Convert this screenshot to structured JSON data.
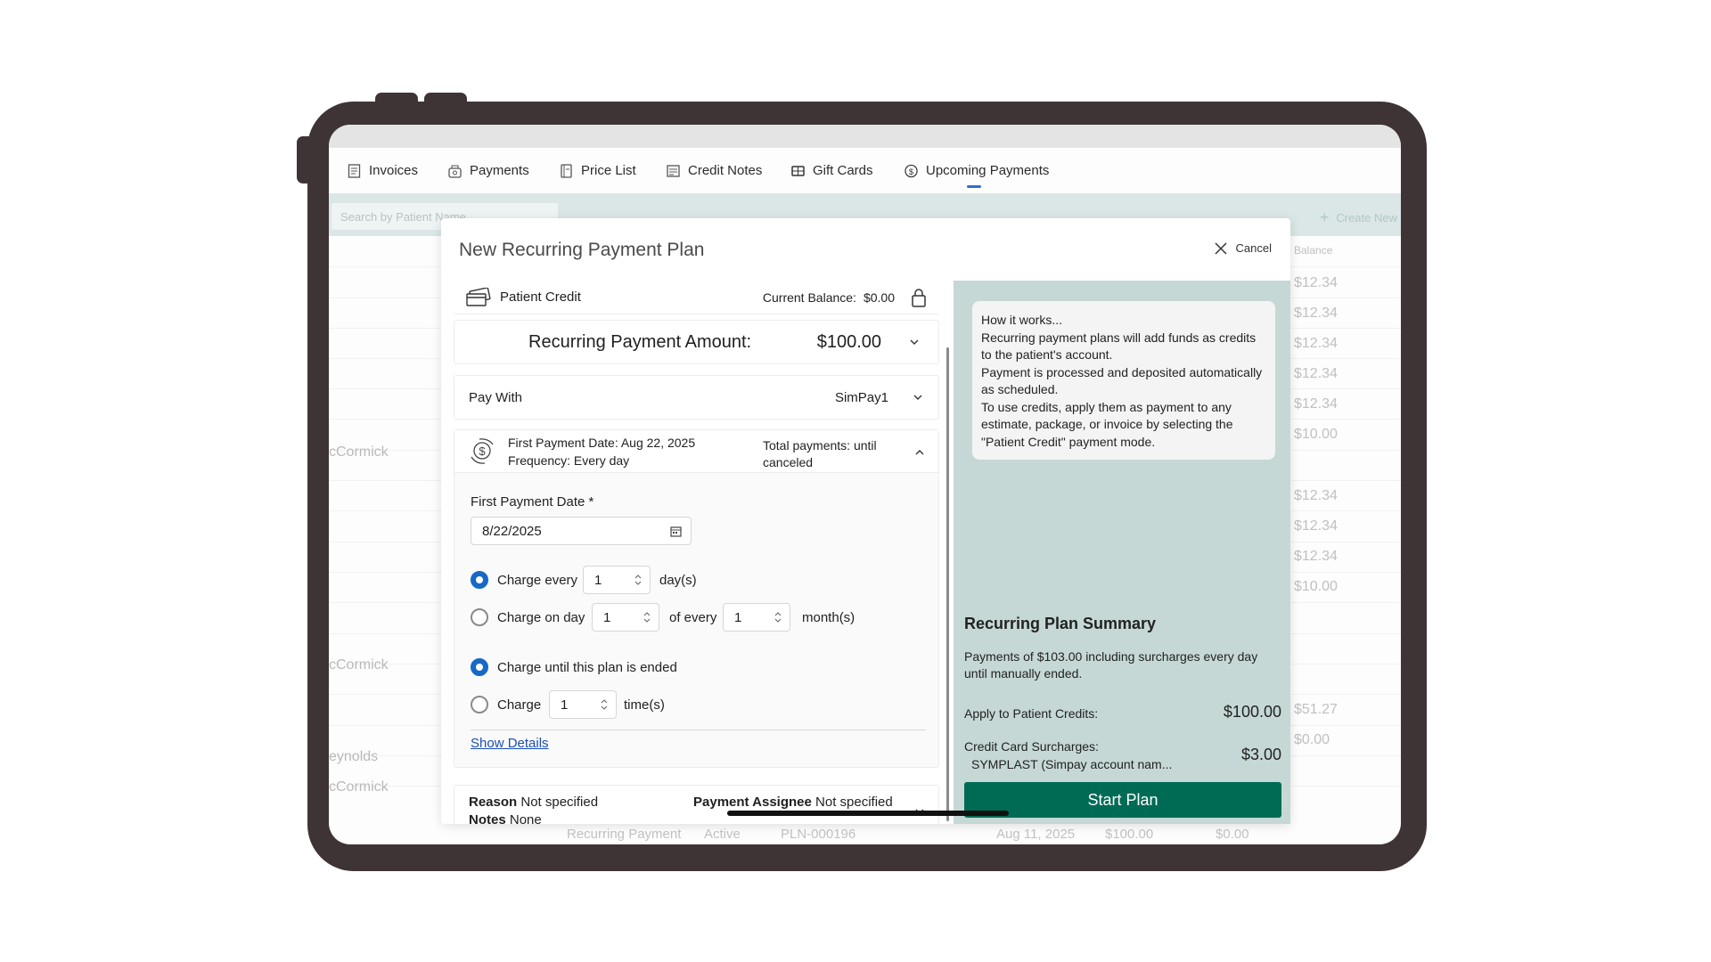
{
  "tabs": [
    {
      "label": "Invoices",
      "icon": "invoice-icon"
    },
    {
      "label": "Payments",
      "icon": "payments-icon"
    },
    {
      "label": "Price List",
      "icon": "price-list-icon"
    },
    {
      "label": "Credit Notes",
      "icon": "credit-notes-icon"
    },
    {
      "label": "Gift Cards",
      "icon": "gift-card-icon"
    },
    {
      "label": "Upcoming Payments",
      "icon": "dollar-circle-icon",
      "active": true
    }
  ],
  "background": {
    "search_placeholder": "Search by Patient Name",
    "create_new": "Create New",
    "balance_header": "Balance",
    "names": [
      "cCormick",
      "cCormick",
      "eynolds",
      "cCormick"
    ],
    "balances": [
      "$12.34",
      "$12.34",
      "$12.34",
      "$12.34",
      "$12.34",
      "$10.00",
      "$12.34",
      "$12.34",
      "$12.34",
      "$10.00",
      "$51.27",
      "$0.00"
    ],
    "bottom_row": {
      "type": "Recurring Payment",
      "status": "Active",
      "plan": "PLN-000196",
      "date": "Aug 11, 2025",
      "amount": "$100.00",
      "balance": "$0.00"
    }
  },
  "modal": {
    "title": "New Recurring Payment Plan",
    "cancel_label": "Cancel",
    "patient_credit_label": "Patient Credit",
    "current_balance_label": "Current Balance:",
    "current_balance_value": "$0.00",
    "recurring_amount_label": "Recurring Payment Amount:",
    "recurring_amount_value": "$100.00",
    "pay_with_label": "Pay With",
    "pay_with_value": "SimPay1",
    "first_payment_summary": "First Payment Date: Aug 22, 2025",
    "frequency_summary": "Frequency: Every day",
    "total_payments": "Total payments: until canceled",
    "first_payment_date_label": "First Payment Date *",
    "first_payment_date_value": "8/22/2025",
    "charge_every_label": "Charge every",
    "charge_every_value": "1",
    "charge_every_unit": "day(s)",
    "charge_on_day_label": "Charge on day",
    "charge_on_day_value": "1",
    "of_every_label": "of every",
    "of_every_value": "1",
    "month_unit": "month(s)",
    "charge_until_label": "Charge until this plan is ended",
    "charge_times_label": "Charge",
    "charge_times_value": "1",
    "times_unit": "time(s)",
    "show_details": "Show Details",
    "reason_label": "Reason",
    "reason_value": "Not specified",
    "assignee_label": "Payment Assignee",
    "assignee_value": "Not specified",
    "notes_label": "Notes",
    "notes_value": "None"
  },
  "how_it_works": {
    "title": "How it works...",
    "lines": [
      "Recurring payment plans will add funds as credits to the patient's account.",
      "Payment is processed and deposited automatically as scheduled.",
      "To use credits, apply them as payment to any estimate, package, or invoice by selecting the \"Patient Credit\" payment mode."
    ]
  },
  "summary": {
    "title": "Recurring Plan Summary",
    "description": "Payments of $103.00 including surcharges every day until manually ended.",
    "apply_label": "Apply to Patient Credits:",
    "apply_value": "$100.00",
    "surcharge_label": "Credit Card Surcharges:",
    "surcharge_account": "SYMPLAST (Simpay account nam...",
    "surcharge_value": "$3.00",
    "start_button": "Start Plan"
  },
  "colors": {
    "accent": "#1769c7",
    "primary_button": "#006b55",
    "side_panel": "#c5d8d5",
    "frame": "#3e3436"
  }
}
